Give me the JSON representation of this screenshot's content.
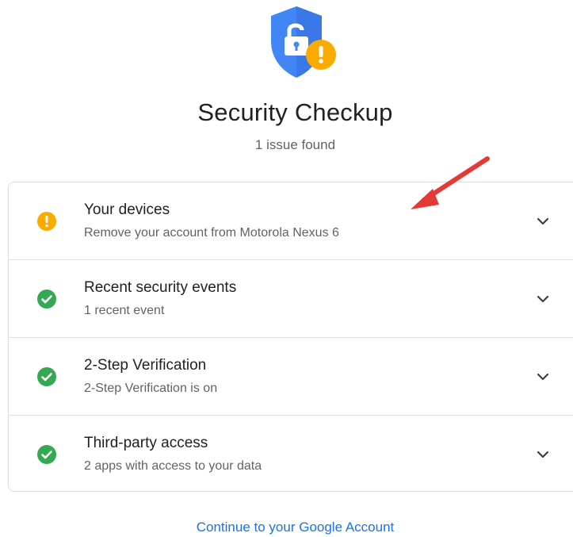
{
  "header": {
    "title": "Security Checkup",
    "subtitle": "1 issue found",
    "hero_icon": "shield-lock-warning-icon"
  },
  "colors": {
    "warning": "#f9ab00",
    "success": "#34a853",
    "shield": "#4285f4",
    "link": "#1a73e8",
    "annotation_arrow": "#e53935"
  },
  "items": [
    {
      "title": "Your devices",
      "subtitle": "Remove your account from Motorola Nexus 6",
      "status": "warning",
      "icon": "warning-icon"
    },
    {
      "title": "Recent security events",
      "subtitle": "1 recent event",
      "status": "ok",
      "icon": "check-circle-icon"
    },
    {
      "title": "2-Step Verification",
      "subtitle": "2-Step Verification is on",
      "status": "ok",
      "icon": "check-circle-icon"
    },
    {
      "title": "Third-party access",
      "subtitle": "2 apps with access to your data",
      "status": "ok",
      "icon": "check-circle-icon"
    }
  ],
  "footer": {
    "continue_label": "Continue to your Google Account"
  }
}
